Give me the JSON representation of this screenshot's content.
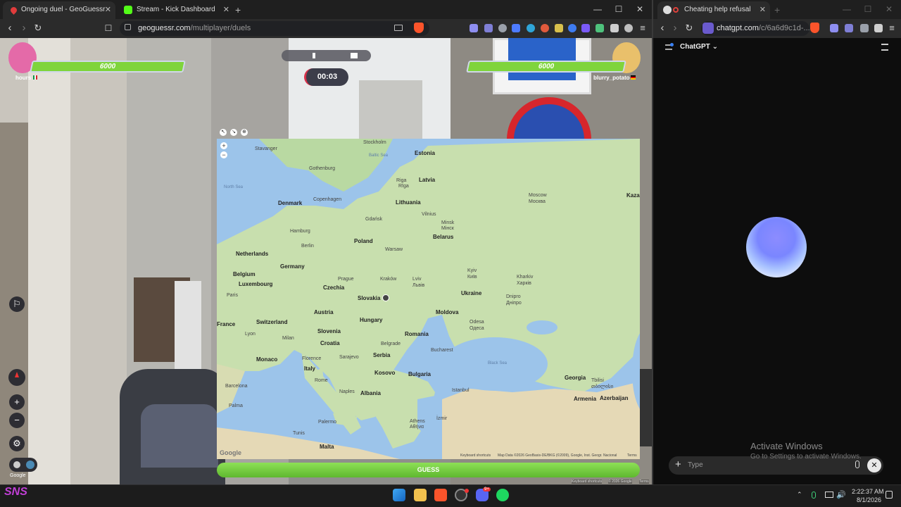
{
  "left_browser": {
    "tabs": [
      {
        "title": "Ongoing duel - GeoGuessr",
        "favicon_color": "#e03c3c"
      },
      {
        "title": "Stream - Kick Dashboard",
        "favicon_color": "#53fc18"
      }
    ],
    "new_tab": "+",
    "window_controls": {
      "minimize": "—",
      "maximize": "☐",
      "close": "✕"
    },
    "url_domain": "geoguessr.com",
    "url_path": "/multiplayer/duels"
  },
  "game": {
    "player_left": {
      "name": "hours",
      "health": "6000",
      "health_fraction": 1.0
    },
    "player_right": {
      "name": "blurry_potato",
      "health": "6000",
      "health_fraction": 1.0
    },
    "timer": "00:03",
    "guess_button": "GUESS",
    "watermark": "Google",
    "map_controls": {
      "zoom_in": "+",
      "zoom_out": "−"
    },
    "side_controls": {
      "zoom_in": "+",
      "zoom_out": "−"
    },
    "map_attribution": [
      "Keyboard shortcuts",
      "Map Data ©2026 GeoBasis-DE/BKG (©2009), Google, Inst. Geogr. Nacional",
      "Terms"
    ],
    "street_attribution": [
      "Keyboard shortcuts",
      "© 2026 Google",
      "Terms"
    ],
    "map_logo": "Google"
  },
  "map_labels": {
    "countries": [
      "Estonia",
      "Latvia",
      "Lithuania",
      "Denmark",
      "Belarus",
      "Poland",
      "Netherlands",
      "Germany",
      "Belgium",
      "Luxembourg",
      "Czechia",
      "Slovakia",
      "Ukraine",
      "Austria",
      "Moldova",
      "Hungary",
      "France",
      "Switzerland",
      "Slovenia",
      "Croatia",
      "Romania",
      "Monaco",
      "Serbia",
      "Italy",
      "Kosovo",
      "Bulgaria",
      "Albania",
      "Georgia",
      "Armenia",
      "Azerbaijan",
      "Malta",
      "Kazan"
    ],
    "cities": [
      "Stockholm",
      "Stavanger",
      "Gothenburg",
      "Riga",
      "Rīga",
      "Moscow",
      "Москва",
      "Copenhagen",
      "Vilnius",
      "Gdańsk",
      "Minsk",
      "Мінск",
      "Hamburg",
      "Berlin",
      "Warsaw",
      "Kharkiv",
      "Харків",
      "Kyiv",
      "Київ",
      "Prague",
      "Kraków",
      "Lviv",
      "Львів",
      "Paris",
      "Dnipro",
      "Дніпро",
      "Odesa",
      "Одеса",
      "Lyon",
      "Milan",
      "Belgrade",
      "Bucharest",
      "Florence",
      "Sarajevo",
      "Barcelona",
      "Rome",
      "Naples",
      "Istanbul",
      "Tbilisi",
      "თბილისი",
      "Palma",
      "Palermo",
      "İzmir",
      "Athens",
      "Αθήνα",
      "Tunis"
    ],
    "seas": [
      "Baltic Sea",
      "North Sea",
      "Black Sea"
    ]
  },
  "right_browser": {
    "tab_title": "Cheating help refusal",
    "new_tab": "+",
    "window_controls": {
      "minimize": "—",
      "maximize": "☐",
      "close": "✕"
    },
    "url_domain": "chatgpt.com",
    "url_path": "/c/6a6d9c1d-...",
    "app_title": "ChatGPT",
    "prompt_placeholder": "Type",
    "activation_title": "Activate Windows",
    "activation_sub": "Go to Settings to activate Windows."
  },
  "taskbar": {
    "time": "2:22:37 AM",
    "date": "8/1/2026",
    "discord_badge": "9+",
    "logo_text": "SNS"
  }
}
